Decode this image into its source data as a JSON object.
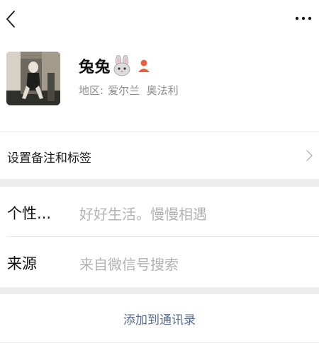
{
  "header": {
    "back_icon": "chevron-left-icon",
    "more_icon": "more-dots-icon"
  },
  "profile": {
    "name": "兔兔",
    "emoji": "rabbit-face-icon",
    "badge_icon": "person-icon",
    "region_label": "地区:",
    "region_value": "爱尔兰  奥法利"
  },
  "remark_row": {
    "label": "设置备注和标签"
  },
  "info": {
    "signature_key": "个性...",
    "signature_value": "好好生活。慢慢相遇",
    "source_key": "来源",
    "source_value": "来自微信号搜索"
  },
  "action": {
    "label": "添加到通讯录"
  },
  "colors": {
    "link": "#576b95",
    "secondary_text": "#8c8c8c",
    "placeholder_text": "#b2b2b2",
    "background": "#ededed",
    "badge": "#e8613c"
  }
}
